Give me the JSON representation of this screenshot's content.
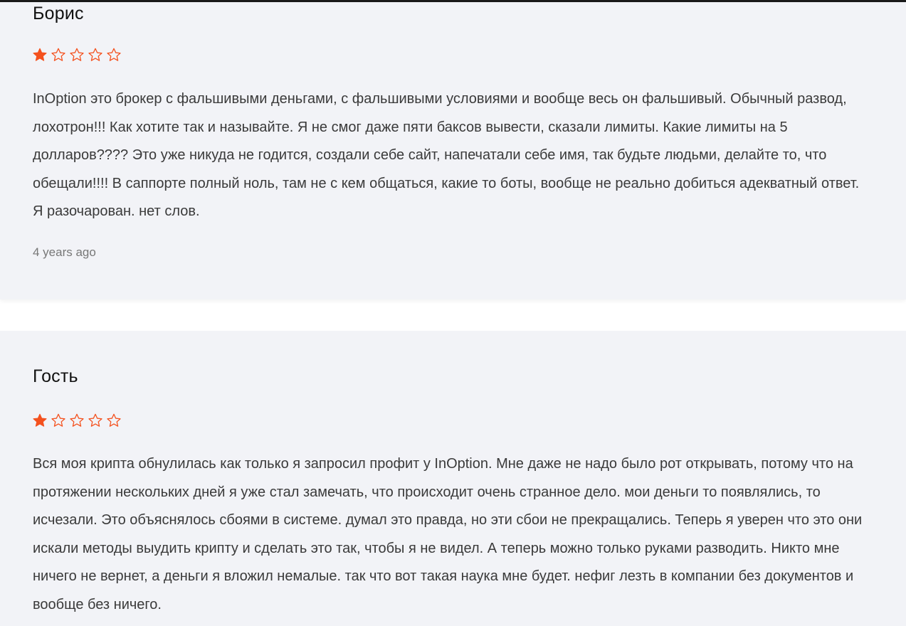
{
  "reviews": [
    {
      "author": "Борис",
      "rating": 1,
      "max_rating": 5,
      "text": "InOption это брокер с фальшивыми деньгами, с фальшивыми условиями и вообще весь он фальшивый. Обычный развод, лохотрон!!! Как хотите так и называйте. Я не смог даже пяти баксов вывести, сказали лимиты. Какие лимиты на 5 долларов???? Это уже никуда не годится, создали себе сайт, напечатали себе имя, так будьте людьми, делайте то, что обещали!!!! В саппорте полный ноль, там не с кем общаться, какие то боты, вообще не реально добиться адекватный ответ. Я разочарован. нет слов.",
      "date": "4 years ago"
    },
    {
      "author": "Гость",
      "rating": 1,
      "max_rating": 5,
      "text": "Вся моя крипта обнулилась как только я запросил профит у InOption. Мне даже не надо было рот открывать, потому что на протяжении нескольких дней я уже стал замечать, что происходит очень странное дело. мои деньги то появлялись, то исчезали. Это объяснялось сбоями в системе. думал это правда, но эти сбои не прекращались. Теперь я уверен что это они искали методы выудить крипту и сделать это так, чтобы я не видел. А теперь можно только руками разводить. Никто мне ничего не вернет, а деньги я вложил немалые. так что вот такая наука мне будет. нефиг лезть в компании без документов и вообще без ничего."
    }
  ],
  "colors": {
    "star_filled": "#f4511e",
    "star_outline": "#f4511e",
    "card_background": "#f2f3f7"
  },
  "icons": {
    "filled_star": "star-filled-icon",
    "empty_star": "star-outline-icon"
  }
}
